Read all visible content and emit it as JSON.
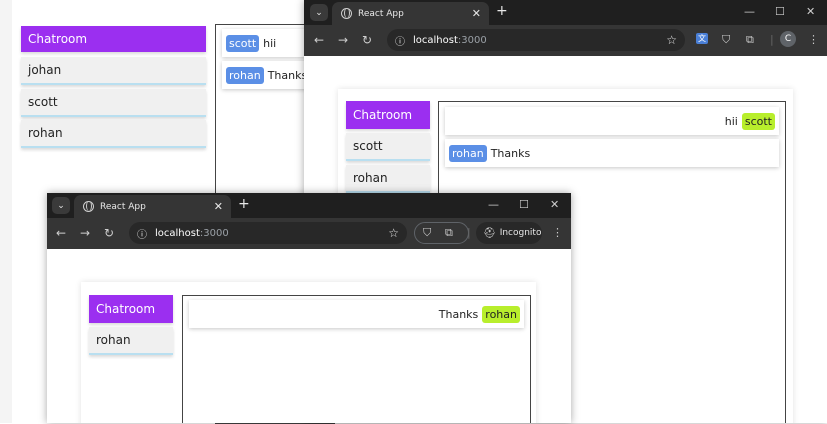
{
  "background_app": {
    "sidebar": {
      "header": "Chatroom",
      "items": [
        "johan",
        "scott",
        "rohan"
      ]
    },
    "messages": [
      {
        "sender": "scott",
        "text": "hii"
      },
      {
        "sender": "rohan",
        "text": "Thanks"
      }
    ]
  },
  "window_right": {
    "tab_title": "React App",
    "url_host": "localhost",
    "url_port": ":3000",
    "avatar_letter": "C",
    "app": {
      "sidebar": {
        "header": "Chatroom",
        "items": [
          "scott",
          "rohan"
        ]
      },
      "messages": [
        {
          "sender": "scott",
          "text": "hii",
          "own": true
        },
        {
          "sender": "rohan",
          "text": "Thanks",
          "own": false
        }
      ]
    }
  },
  "window_front": {
    "tab_title": "React App",
    "url_host": "localhost",
    "url_port": ":3000",
    "incognito_label": "Incognito",
    "app": {
      "sidebar": {
        "header": "Chatroom",
        "items": [
          "rohan"
        ]
      },
      "messages": [
        {
          "sender": "rohan",
          "text": "Thanks",
          "own": true
        }
      ]
    }
  },
  "colors": {
    "header_purple": "#9b2ff0",
    "badge_blue": "#5b8fe6",
    "badge_green": "#b8ee2c"
  }
}
